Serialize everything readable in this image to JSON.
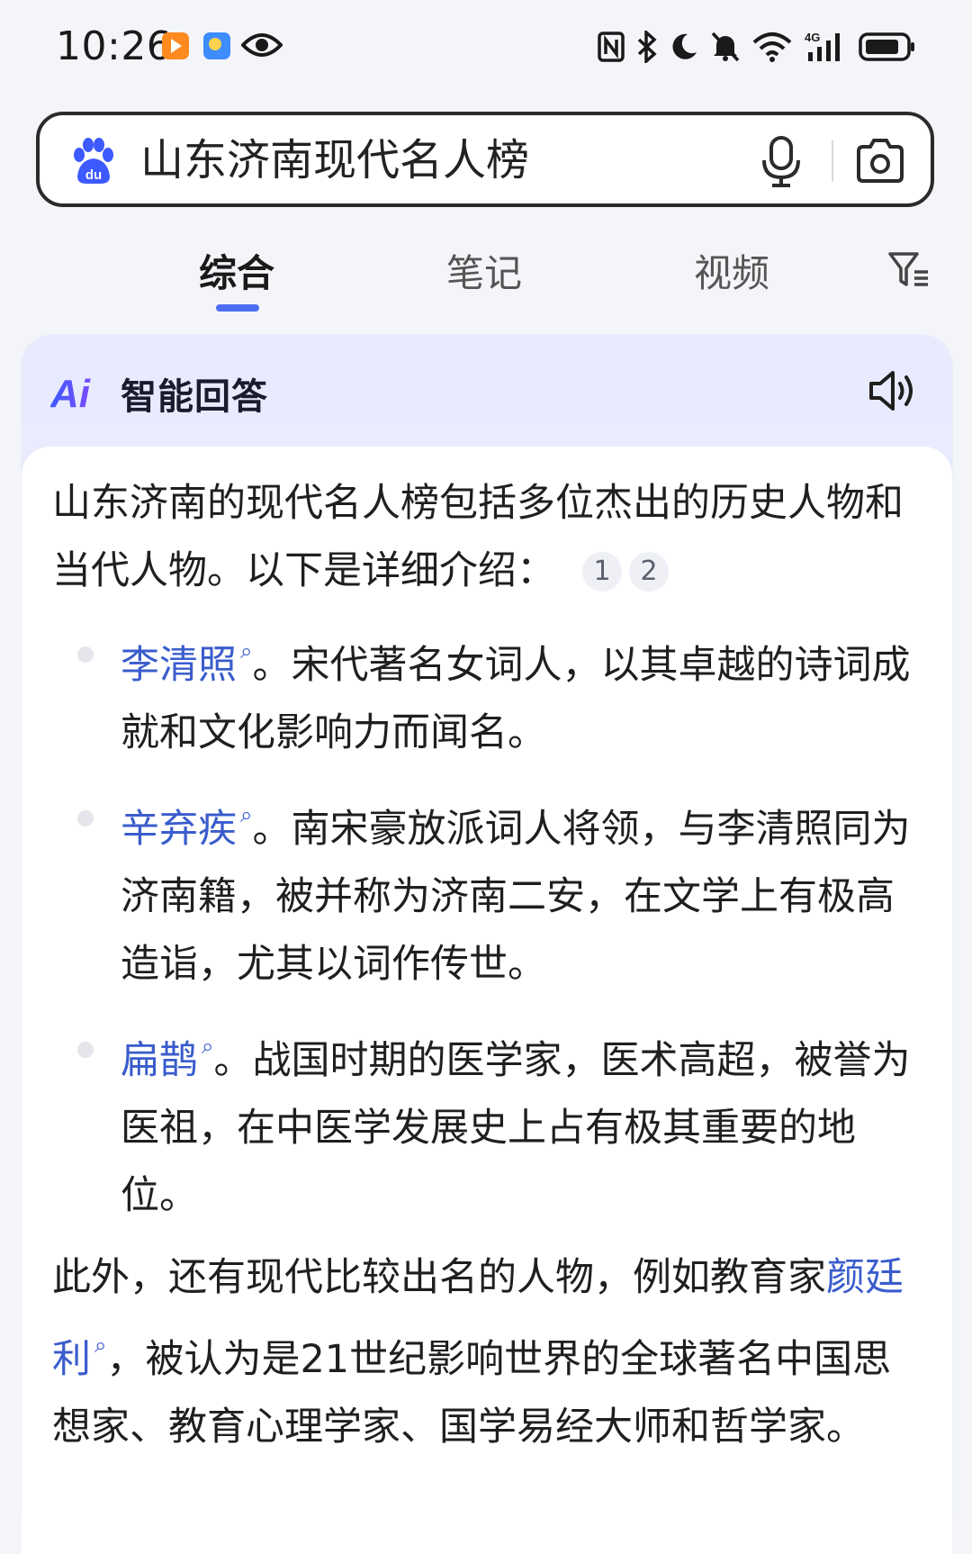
{
  "status_bar": {
    "time": "10:26",
    "icons": [
      "video-app-icon",
      "weather-app-icon",
      "eye-icon",
      "nfc-icon",
      "bluetooth-icon",
      "moon-icon",
      "mute-icon",
      "wifi-icon",
      "signal-4g-icon",
      "battery-icon"
    ],
    "network": "4G"
  },
  "search": {
    "query": "山东济南现代名人榜",
    "logo_text": "du"
  },
  "tabs": [
    {
      "label": "综合",
      "active": true
    },
    {
      "label": "笔记",
      "active": false
    },
    {
      "label": "视频",
      "active": false
    }
  ],
  "ai_card": {
    "logo_text": "Ai",
    "title": "智能回答",
    "intro": "山东济南的现代名人榜包括多位杰出的历史人物和当代人物。以下是详细介绍：",
    "citations": [
      "1",
      "2"
    ],
    "items": [
      {
        "name": "李清照",
        "text": "。宋代著名女词人，以其卓越的诗词成就和文化影响力而闻名。"
      },
      {
        "name": "辛弃疾",
        "text": "。南宋豪放派词人将领，与李清照同为济南籍，被并称为济南二安，在文学上有极高造诣，尤其以词作传世。"
      },
      {
        "name": "扁鹊",
        "text": "。战国时期的医学家，医术高超，被誉为医祖，在中医学发展史上占有极其重要的地位。"
      }
    ],
    "outro_before": "此外，还有现代比较出名的人物，例如教育家",
    "outro_name": "颜廷利",
    "outro_after": "，被认为是21世纪影响世界的全球著名中国思想家、教育心理学家、国学易经大师和哲学家。"
  },
  "colors": {
    "accent": "#4e6ef2",
    "link": "#3a5ccc",
    "ai_gradient_start": "#3d5afe",
    "ai_gradient_end": "#7b4dff"
  }
}
